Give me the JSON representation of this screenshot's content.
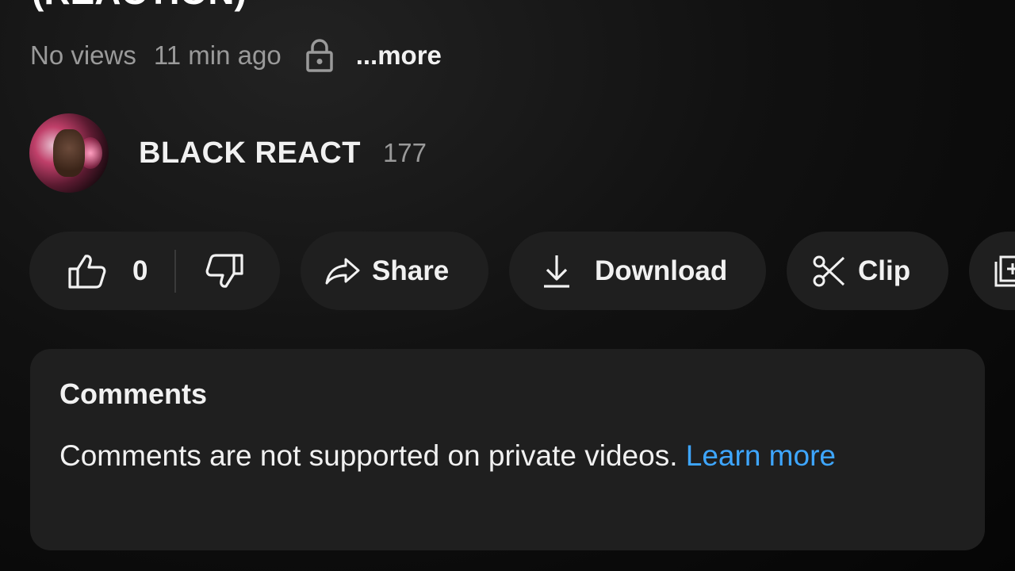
{
  "video": {
    "title": "(REACTION)",
    "views": "No views",
    "age": "11 min ago",
    "more_label": "...more"
  },
  "channel": {
    "name": "BLACK REACT",
    "subscriber_count": "177"
  },
  "actions": {
    "like_count": "0",
    "share_label": "Share",
    "download_label": "Download",
    "clip_label": "Clip"
  },
  "comments": {
    "heading": "Comments",
    "message": "Comments are not supported on private videos.",
    "link_label": "Learn more"
  },
  "colors": {
    "background": "#0f0f0f",
    "pill": "#1f1f1f",
    "link": "#3ea6ff",
    "secondary_text": "#9a9a9a"
  },
  "icons": {
    "privacy": "lock-icon",
    "like": "thumbs-up-icon",
    "dislike": "thumbs-down-icon",
    "share": "share-arrow-icon",
    "download": "download-icon",
    "clip": "scissors-icon",
    "save": "save-playlist-icon"
  }
}
